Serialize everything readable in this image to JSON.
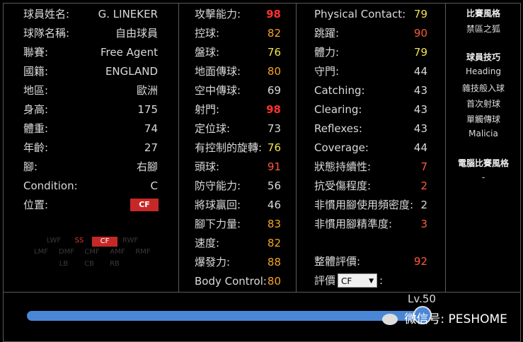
{
  "profile": {
    "rows": [
      {
        "label": "球員姓名:",
        "value": "G. LINEKER"
      },
      {
        "label": "球隊名稱:",
        "value": "自由球員"
      },
      {
        "label": "聯賽:",
        "value": "Free Agent"
      },
      {
        "label": "國籍:",
        "value": "ENGLAND"
      },
      {
        "label": "地區:",
        "value": "歐洲"
      },
      {
        "label": "身高:",
        "value": "175"
      },
      {
        "label": "體重:",
        "value": "74"
      },
      {
        "label": "年齡:",
        "value": "27"
      },
      {
        "label": "腳:",
        "value": "右腳"
      },
      {
        "label": "Condition:",
        "value": "C"
      },
      {
        "label": "位置:",
        "value": ""
      }
    ],
    "position_badge": "CF"
  },
  "position_map": {
    "row1": [
      "LWF",
      "SS",
      "CF",
      "RWF"
    ],
    "row2": [
      "LMF",
      "DMF",
      "CMF",
      "AMF",
      "RMF"
    ],
    "row3": [
      "LB",
      "CB",
      "RB"
    ]
  },
  "stats_mid": [
    {
      "label": "攻擊能力:",
      "value": "98",
      "color": "red"
    },
    {
      "label": "控球:",
      "value": "82",
      "color": "orange"
    },
    {
      "label": "盤球:",
      "value": "76",
      "color": "yellow"
    },
    {
      "label": "地面傳球:",
      "value": "80",
      "color": "orange"
    },
    {
      "label": "空中傳球:",
      "value": "69",
      "color": "white"
    },
    {
      "label": "射門:",
      "value": "98",
      "color": "red"
    },
    {
      "label": "定位球:",
      "value": "73",
      "color": "white"
    },
    {
      "label": "有控制的旋轉:",
      "value": "76",
      "color": "yellow"
    },
    {
      "label": "頭球:",
      "value": "91",
      "color": "bred"
    },
    {
      "label": "防守能力:",
      "value": "56",
      "color": "white"
    },
    {
      "label": "將球贏回:",
      "value": "46",
      "color": "white"
    },
    {
      "label": "腳下力量:",
      "value": "83",
      "color": "orange"
    },
    {
      "label": "速度:",
      "value": "82",
      "color": "orange"
    },
    {
      "label": "爆發力:",
      "value": "88",
      "color": "orange"
    },
    {
      "label": "Body Control:",
      "value": "80",
      "color": "orange"
    }
  ],
  "stats_right": [
    {
      "label": "Physical Contact:",
      "value": "79",
      "color": "yellow"
    },
    {
      "label": "跳躍:",
      "value": "90",
      "color": "bred"
    },
    {
      "label": "體力:",
      "value": "79",
      "color": "yellow"
    },
    {
      "label": "守門:",
      "value": "44",
      "color": "white"
    },
    {
      "label": "Catching:",
      "value": "43",
      "color": "white"
    },
    {
      "label": "Clearing:",
      "value": "43",
      "color": "white"
    },
    {
      "label": "Reflexes:",
      "value": "43",
      "color": "white"
    },
    {
      "label": "Coverage:",
      "value": "44",
      "color": "white"
    },
    {
      "label": "狀態持續性:",
      "value": "7",
      "color": "bred"
    },
    {
      "label": "抗受傷程度:",
      "value": "2",
      "color": "bred"
    },
    {
      "label": "非慣用腳使用頻密度:",
      "value": "2",
      "color": "white"
    },
    {
      "label": "非慣用腳精準度:",
      "value": "3",
      "color": "bred"
    }
  ],
  "overall": {
    "label": "整體評價:",
    "value": "92"
  },
  "rating": {
    "label": "評價",
    "selected": "CF",
    "suffix": ":"
  },
  "sidebar": {
    "style_title": "比賽風格",
    "style_value": "禁區之狐",
    "skills_title": "球員技巧",
    "skills": [
      "Heading",
      "雜技般入球",
      "首次射球",
      "單觸傳球",
      "Malicia"
    ],
    "ai_title": "電腦比賽風格",
    "ai_value": "-"
  },
  "level": {
    "label": "Lv.50",
    "progress_fraction": 1.0
  },
  "watermark": "微信号: PESHOME",
  "colors": {
    "red": "#ff3030",
    "orange": "#f5a623",
    "yellow": "#f3e24d",
    "bred": "#ff5a36",
    "white": "#dadada",
    "accent": "#4a86d6",
    "badge": "#c62828"
  }
}
